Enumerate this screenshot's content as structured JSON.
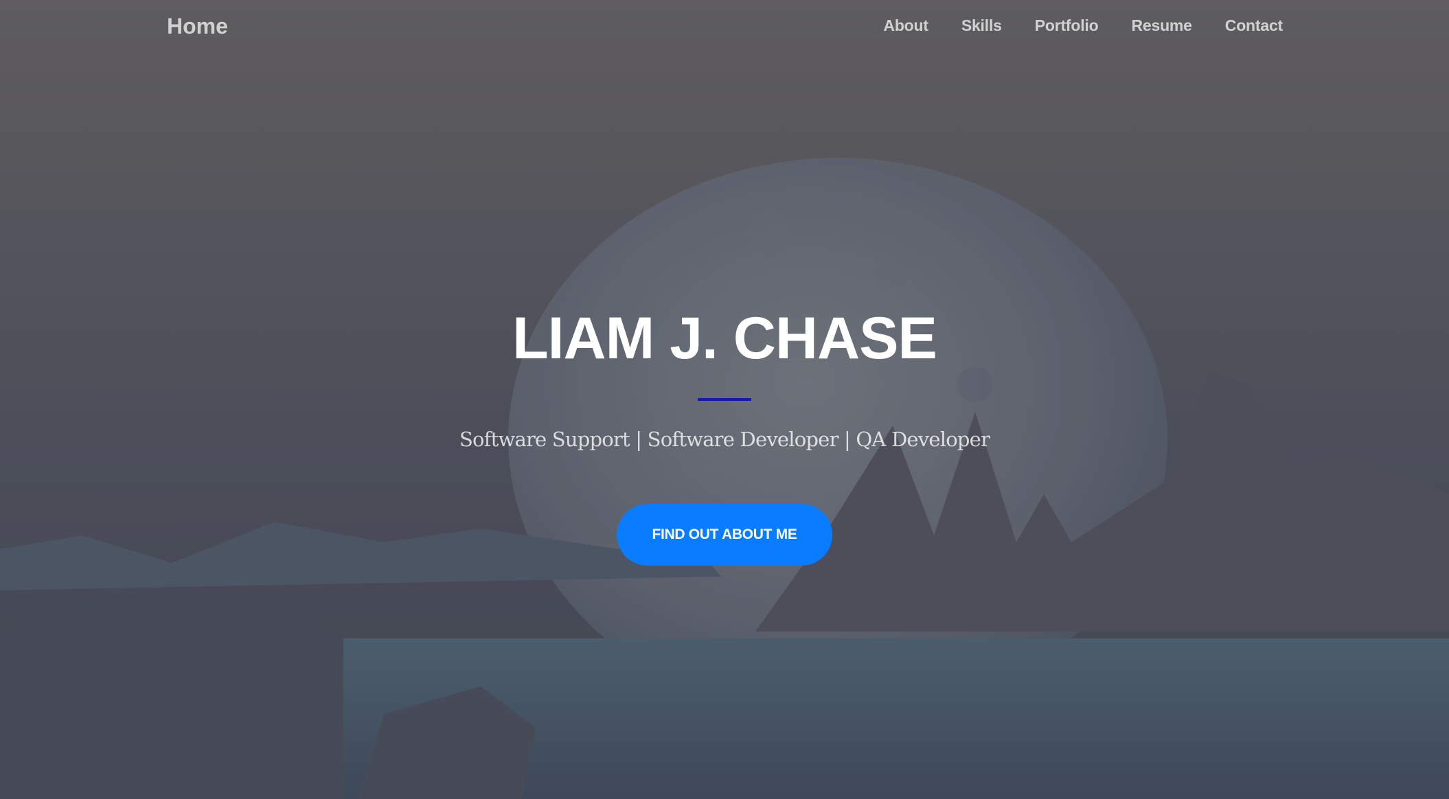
{
  "nav": {
    "brand": "Home",
    "links": [
      "About",
      "Skills",
      "Portfolio",
      "Resume",
      "Contact"
    ]
  },
  "hero": {
    "title": "LIAM J. CHASE",
    "subtitle": "Software Support | Software Developer | QA Developer",
    "cta_label": "FIND OUT ABOUT ME"
  },
  "colors": {
    "accent": "#0a7cff",
    "divider": "#1414c8",
    "overlay": "#5a5a60"
  }
}
